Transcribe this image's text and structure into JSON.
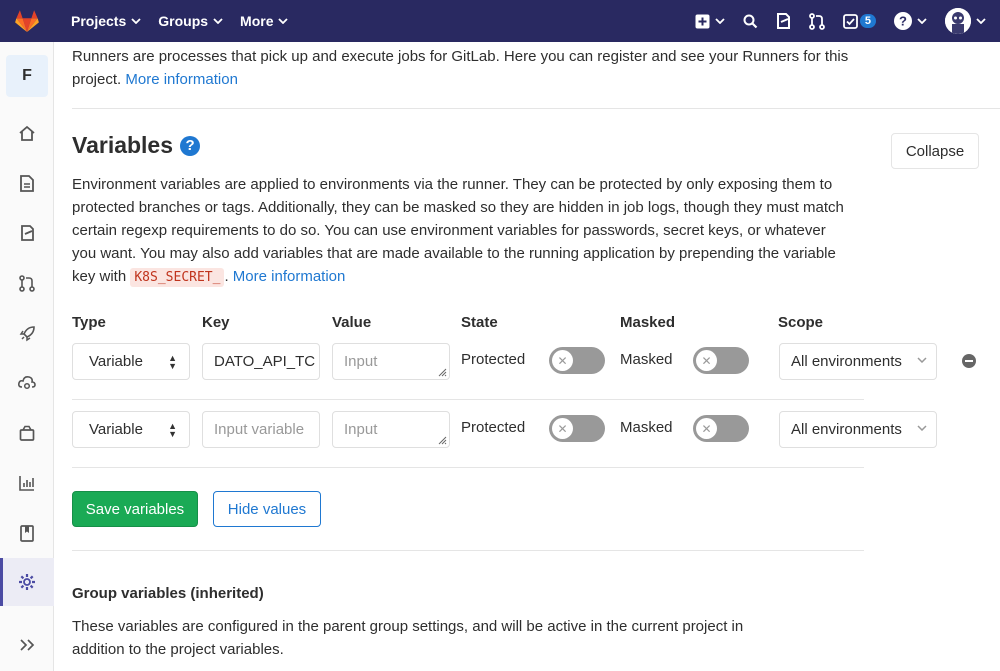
{
  "navbar": {
    "items": [
      {
        "label": "Projects"
      },
      {
        "label": "Groups"
      },
      {
        "label": "More"
      }
    ],
    "todo_count": "5",
    "icons": [
      "plus-icon",
      "search-icon",
      "issues-icon",
      "merge-request-icon",
      "todo-icon",
      "help-icon",
      "avatar"
    ]
  },
  "sidebar": {
    "project_letter": "F",
    "icons": [
      "home-icon",
      "repository-icon",
      "issues-icon",
      "merge-requests-icon",
      "cicd-rocket-icon",
      "operations-icon",
      "packages-icon",
      "analytics-icon",
      "wiki-icon",
      "settings-icon",
      "collapse-sidebar-icon"
    ],
    "active": "settings-icon"
  },
  "runners": {
    "text": "Runners are processes that pick up and execute jobs for GitLab. Here you can register and see your Runners for this project.",
    "link": "More information"
  },
  "variables": {
    "title": "Variables",
    "collapse_label": "Collapse",
    "desc_before": "Environment variables are applied to environments via the runner. They can be protected by only exposing them to protected branches or tags. Additionally, they can be masked so they are hidden in job logs, though they must match certain regexp requirements to do so. You can use environment variables for passwords, secret keys, or whatever you want. You may also add variables that are made available to the running application by prepending the variable key with",
    "code": "K8S_SECRET_",
    "desc_after": ".",
    "link": "More information",
    "headers": {
      "type": "Type",
      "key": "Key",
      "value": "Value",
      "state": "State",
      "masked": "Masked",
      "scope": "Scope"
    },
    "rows": [
      {
        "type": "Variable",
        "key": "DATO_API_TC",
        "value_placeholder": "Input",
        "state_label": "Protected",
        "masked_label": "Masked",
        "scope": "All environments"
      },
      {
        "type": "Variable",
        "key_placeholder": "Input variable",
        "value_placeholder": "Input",
        "state_label": "Protected",
        "masked_label": "Masked",
        "scope": "All environments"
      }
    ],
    "save_label": "Save variables",
    "hide_label": "Hide values"
  },
  "group_vars": {
    "title": "Group variables (inherited)",
    "desc": "These variables are configured in the parent group settings, and will be active in the current project in addition to the project variables."
  }
}
